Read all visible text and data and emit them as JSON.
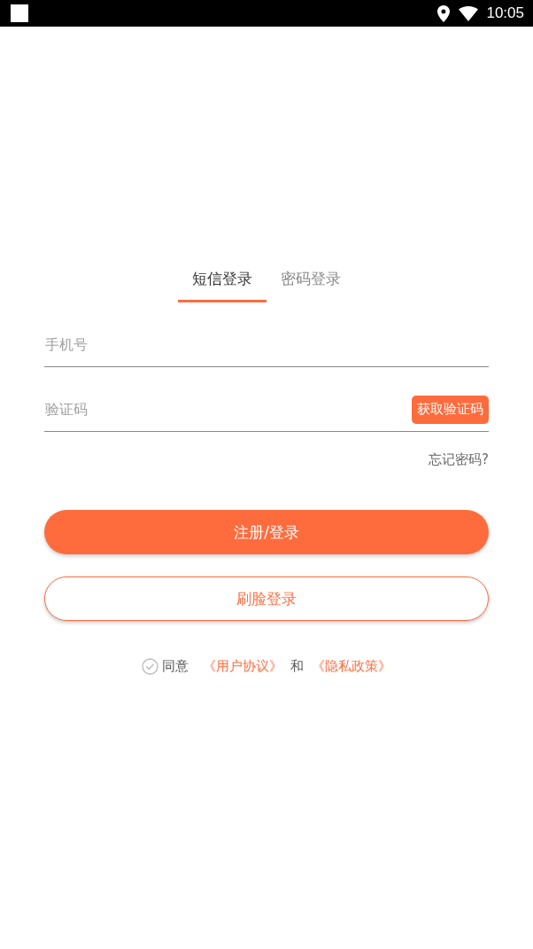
{
  "status_bar": {
    "time": "10:05"
  },
  "tabs": [
    {
      "label": "短信登录",
      "selected": true
    },
    {
      "label": "密码登录",
      "selected": false
    }
  ],
  "fields": [
    {
      "kind": "text",
      "placeholder": "手机号"
    },
    {
      "kind": "code",
      "placeholder": "验证码",
      "action": "获取验证码"
    }
  ],
  "forgot_link": "忘记密码?",
  "buttons": [
    {
      "kind": "filled",
      "label": "注册/登录"
    },
    {
      "kind": "outline",
      "label": "刷脸登录"
    }
  ],
  "agreement": {
    "checked": false,
    "text": "同意",
    "links": [
      "《用户协议》",
      "《隐私政策》"
    ],
    "joiner": "和"
  }
}
